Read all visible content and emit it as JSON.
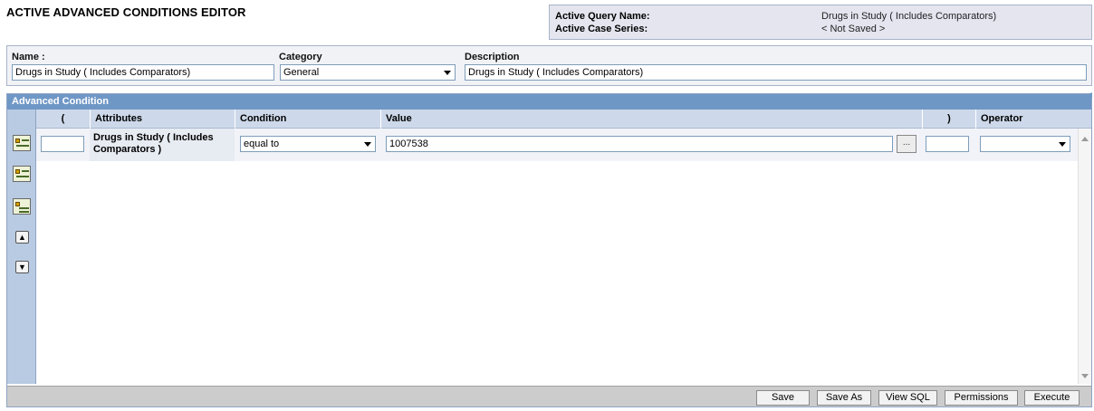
{
  "page": {
    "title": "ACTIVE ADVANCED CONDITIONS EDITOR"
  },
  "active_query": {
    "query_label": "Active Query Name:",
    "query_value": "Drugs in Study ( Includes Comparators)",
    "series_label": "Active Case Series:",
    "series_value": "< Not Saved >"
  },
  "header_form": {
    "name_label": "Name :",
    "name_value": "Drugs in Study ( Includes Comparators)",
    "category_label": "Category",
    "category_value": "General",
    "description_label": "Description",
    "description_value": "Drugs in Study ( Includes Comparators)"
  },
  "advanced_condition": {
    "title": "Advanced Condition",
    "toolbar_icons": [
      "add-condition-icon",
      "insert-condition-icon",
      "group-condition-icon",
      "move-up-icon",
      "move-down-icon"
    ],
    "columns": {
      "open_paren": "(",
      "attributes": "Attributes",
      "condition": "Condition",
      "value": "Value",
      "close_paren": ")",
      "operator": "Operator"
    },
    "rows": [
      {
        "open_paren": "",
        "attribute": "Drugs in Study ( Includes Comparators )",
        "condition": "equal to",
        "value": "1007538",
        "value_button": "...",
        "close_paren": "",
        "operator": ""
      }
    ]
  },
  "footer": {
    "save": "Save",
    "save_as": "Save As",
    "view_sql": "View SQL",
    "permissions": "Permissions",
    "execute": "Execute"
  }
}
